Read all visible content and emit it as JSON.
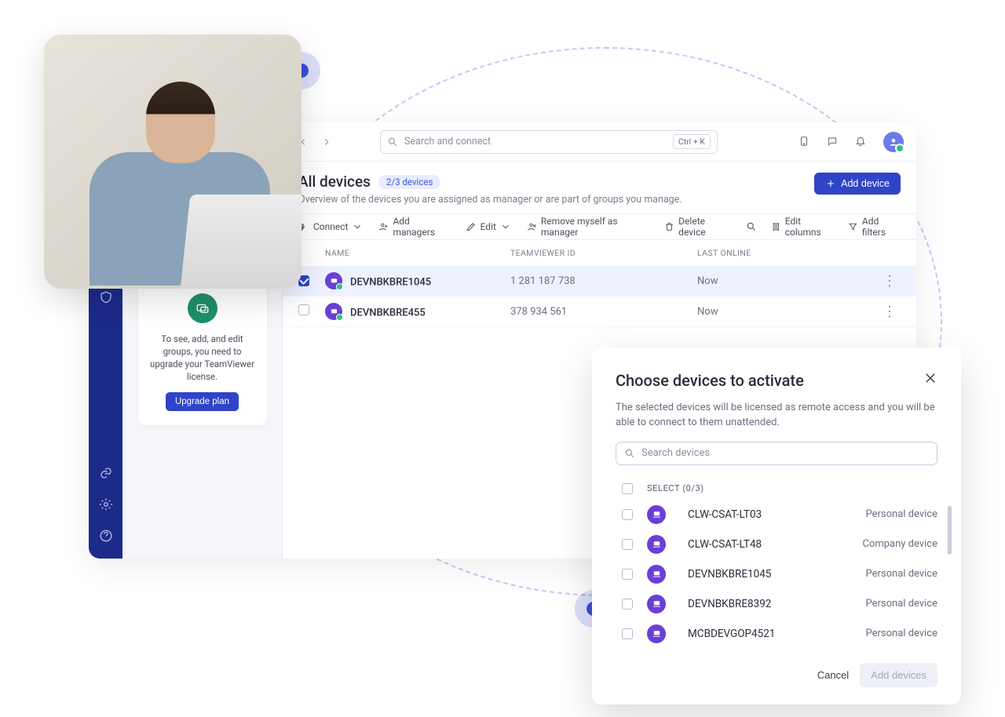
{
  "header": {
    "search_placeholder": "Search and connect",
    "shortcut": "Ctrl + K"
  },
  "page": {
    "title": "All devices",
    "badge": "2/3 devices",
    "subtitle": "Overview of the devices you are assigned as manager or are part of groups you manage.",
    "add_btn": "Add device"
  },
  "toolbar": {
    "connect": "Connect",
    "add_managers": "Add managers",
    "edit": "Edit",
    "remove": "Remove myself as manager",
    "delete": "Delete device",
    "edit_columns": "Edit columns",
    "add_filters": "Add filters"
  },
  "columns": {
    "name": "NAME",
    "id": "TEAMVIEWER ID",
    "last": "LAST ONLINE"
  },
  "rows": [
    {
      "name": "DEVNBKBRE1045",
      "id": "1 281 187 738",
      "last": "Now",
      "selected": true
    },
    {
      "name": "DEVNBKBRE455",
      "id": "378 934 561",
      "last": "Now",
      "selected": false
    }
  ],
  "upsell": {
    "text": "To see, add, and edit groups, you need to upgrade your TeamViewer license.",
    "button": "Upgrade plan"
  },
  "dialog": {
    "title": "Choose devices to activate",
    "subtitle": "The selected devices will be licensed as remote access and you will be able to connect to them unattended.",
    "search_placeholder": "Search devices",
    "select_label": "SELECT (0/3)",
    "cancel": "Cancel",
    "confirm": "Add devices",
    "items": [
      {
        "name": "CLW-CSAT-LT03",
        "type": "Personal device"
      },
      {
        "name": "CLW-CSAT-LT48",
        "type": "Company device"
      },
      {
        "name": "DEVNBKBRE1045",
        "type": "Personal device"
      },
      {
        "name": "DEVNBKBRE8392",
        "type": "Personal device"
      },
      {
        "name": "MCBDEVGOP4521",
        "type": "Personal device"
      }
    ]
  }
}
